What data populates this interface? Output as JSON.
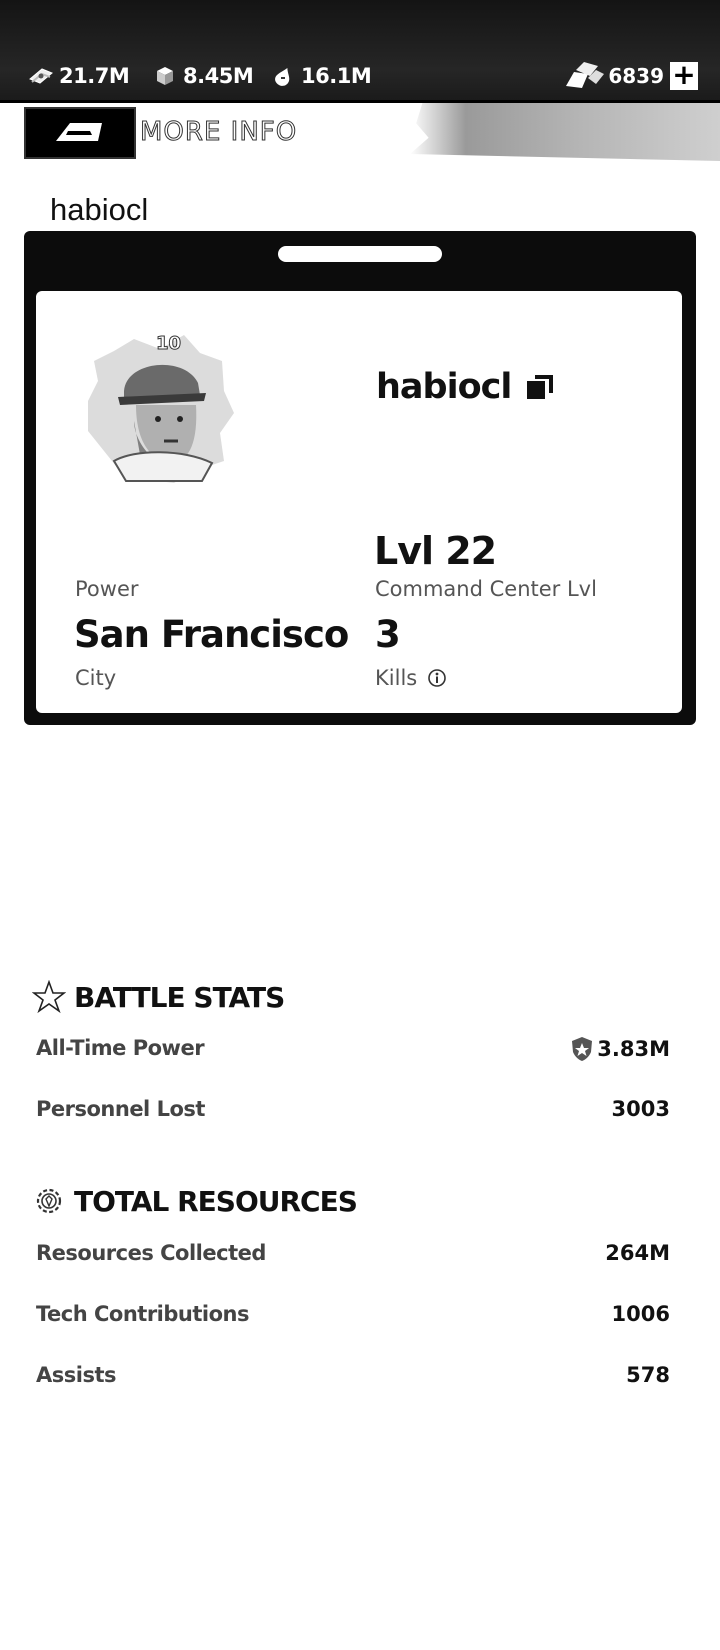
{
  "topbar": {
    "resources": [
      {
        "icon": "cash-icon",
        "value": "21.7M"
      },
      {
        "icon": "supply-crate-icon",
        "value": "8.45M"
      },
      {
        "icon": "fuel-drop-icon",
        "value": "16.1M"
      }
    ],
    "gold": {
      "icon": "gold-bars-icon",
      "value": "6839",
      "add_label": "+"
    }
  },
  "header": {
    "back_icon": "back-arrow-icon",
    "title": "MORE INFO"
  },
  "page_username": "habiocl",
  "profile": {
    "avatar_icon": "soldier-avatar-icon",
    "name": "habiocl",
    "copy_icon": "copy-icon",
    "level_value": "Lvl 22",
    "level_label": "Command Center Lvl",
    "power_label": "Power",
    "city_value": "San Francisco",
    "city_label": "City",
    "kills_value": "3",
    "kills_label": "Kills",
    "kills_info_icon": "info-icon"
  },
  "battle_stats": {
    "icon": "star-icon",
    "title": "BATTLE STATS",
    "rows": [
      {
        "label": "All-Time Power",
        "value": "3.83M",
        "icon": "power-shield-icon"
      },
      {
        "label": "Personnel Lost",
        "value": "3003"
      }
    ]
  },
  "total_resources": {
    "icon": "gear-icon",
    "title": "TOTAL RESOURCES",
    "rows": [
      {
        "label": "Resources Collected",
        "value": "264M"
      },
      {
        "label": "Tech Contributions",
        "value": "1006"
      },
      {
        "label": "Assists",
        "value": "578"
      }
    ]
  }
}
